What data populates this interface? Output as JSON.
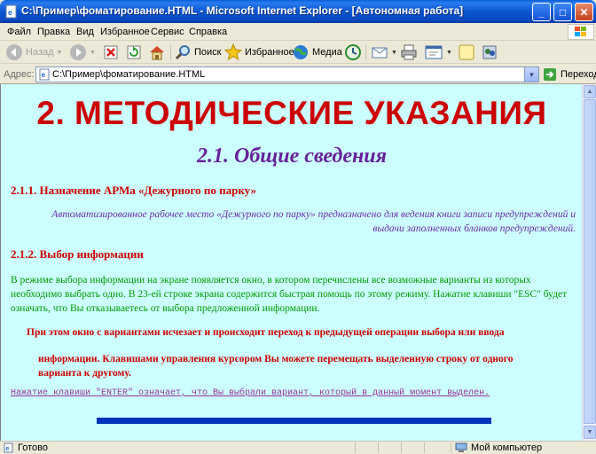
{
  "window": {
    "title": "C:\\Пример\\фоматирование.HTML - Microsoft Internet Explorer - [Автономная работа]",
    "minimize_glyph": "_",
    "maximize_glyph": "□",
    "close_glyph": "✕"
  },
  "menu": {
    "items": [
      "Файл",
      "Правка",
      "Вид",
      "Избранное",
      "Сервис",
      "Справка"
    ]
  },
  "toolbar": {
    "back_label": "Назад",
    "search_label": "Поиск",
    "favorites_label": "Избранное",
    "media_label": "Медиа"
  },
  "address": {
    "label": "Адрес:",
    "value": "C:\\Пример\\фоматирование.HTML",
    "go_label": "Переход"
  },
  "page": {
    "h1": "2. МЕТОДИЧЕСКИЕ УКАЗАНИЯ",
    "h2": "2.1. Общие сведения",
    "h3_1": "2.1.1. Назначение АРМа «Дежурного по парку»",
    "p1": "Автоматизированное рабочее место «Дежурного по парку» предназначено для ведения книги записи предупреждений и выдачи заполненных бланков предупреждений.",
    "h3_2": "2.1.2. Выбор информации",
    "p2": "В режиме выбора информации на экране появляется окно, в котором перечислены все возможные варианты из которых необходимо выбрать одно. В 23-ей строке экрана содержится быстрая помощь по этому режиму. Нажатие клавиши \"ESC\" будет означать, что Вы отказываетесь от выбора предложенной информации.",
    "p3": "При этом окно с вариантами исчезает и происходит переход к предыдущей операции выбора или ввода",
    "p4": "информации. Клавишами управления курсором Вы можете перемещать выделенную строку от одного варианта к другому.",
    "p5": "Нажатие клавиши \"ENTER\" означает, что Вы выбрали вариант, который в данный момент выделен."
  },
  "status": {
    "left": "Готово",
    "right": "Мой компьютер"
  },
  "colors": {
    "page_background": "#ccffff",
    "heading_red": "#cc0000",
    "heading_purple": "#662299",
    "text_green": "#009900",
    "rule_blue": "#0033bb"
  }
}
